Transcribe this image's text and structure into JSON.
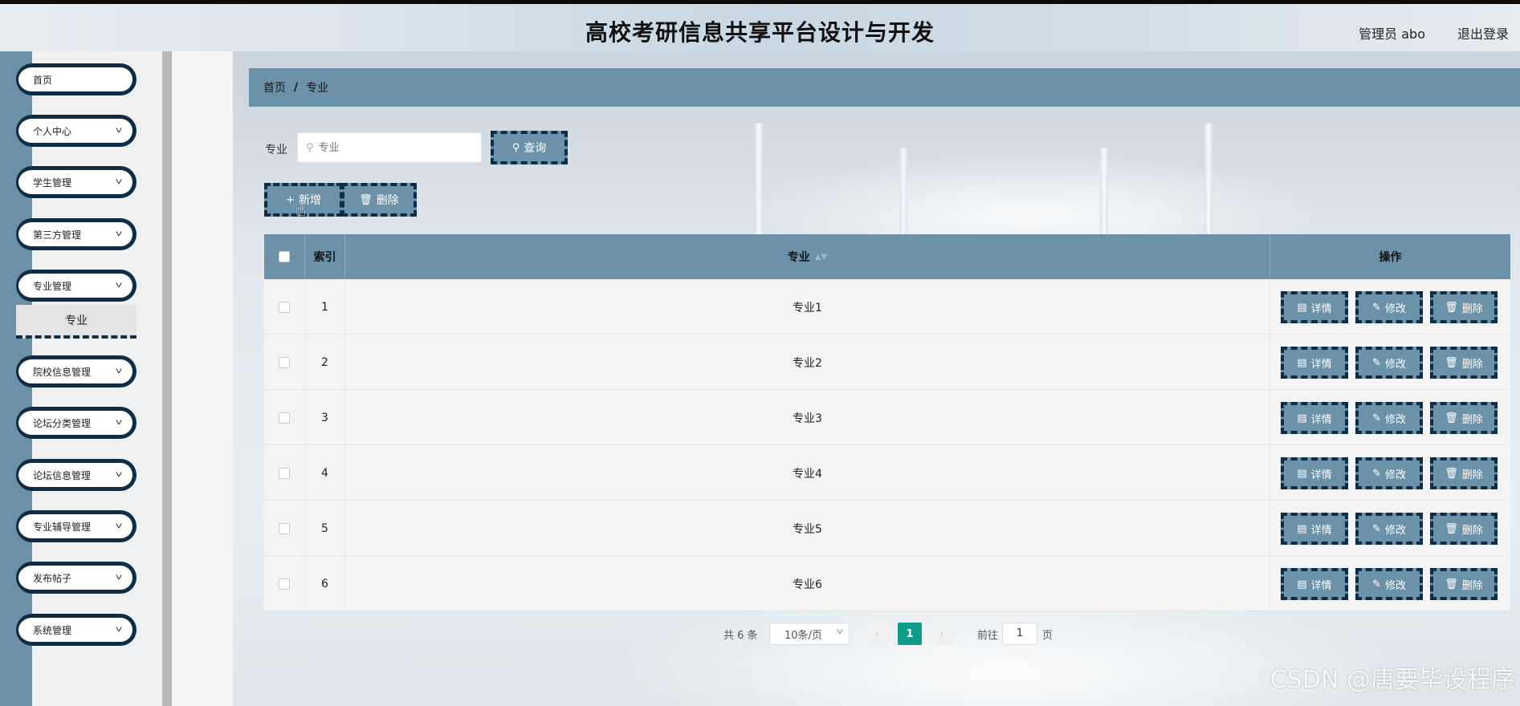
{
  "header": {
    "title": "高校考研信息共享平台设计与开发",
    "user": "管理员 abo",
    "logout": "退出登录"
  },
  "sidebar": {
    "items": [
      {
        "label": "首页",
        "has_chevron": false
      },
      {
        "label": "个人中心",
        "has_chevron": true
      },
      {
        "label": "学生管理",
        "has_chevron": true
      },
      {
        "label": "第三方管理",
        "has_chevron": true
      },
      {
        "label": "专业管理",
        "has_chevron": true
      },
      {
        "label": "院校信息管理",
        "has_chevron": true
      },
      {
        "label": "论坛分类管理",
        "has_chevron": true
      },
      {
        "label": "论坛信息管理",
        "has_chevron": true
      },
      {
        "label": "专业辅导管理",
        "has_chevron": true
      },
      {
        "label": "发布帖子",
        "has_chevron": true
      },
      {
        "label": "系统管理",
        "has_chevron": true
      }
    ],
    "submenu_active": "专业"
  },
  "breadcrumb": {
    "home": "首页",
    "separator": "/",
    "current": "专业"
  },
  "search": {
    "label": "专业",
    "placeholder": "专业",
    "value": "",
    "button": "查询"
  },
  "actions": {
    "add": "新增",
    "delete": "删除"
  },
  "table": {
    "headers": {
      "index": "索引",
      "major": "专业",
      "ops": "操作"
    },
    "rows": [
      {
        "index": "1",
        "major": "专业1"
      },
      {
        "index": "2",
        "major": "专业2"
      },
      {
        "index": "3",
        "major": "专业3"
      },
      {
        "index": "4",
        "major": "专业4"
      },
      {
        "index": "5",
        "major": "专业5"
      },
      {
        "index": "6",
        "major": "专业6"
      }
    ],
    "row_buttons": {
      "detail": "详情",
      "edit": "修改",
      "delete": "删除"
    }
  },
  "pagination": {
    "total": "共 6 条",
    "page_size": "10条/页",
    "current_page": "1",
    "goto_label": "前往",
    "goto_value": "1",
    "goto_unit": "页"
  },
  "watermark": "CSDN @唐要毕设程序",
  "colors": {
    "accent": "#6b92a9",
    "border_dark": "#0f2d46",
    "page_active": "#0f9d8a"
  }
}
